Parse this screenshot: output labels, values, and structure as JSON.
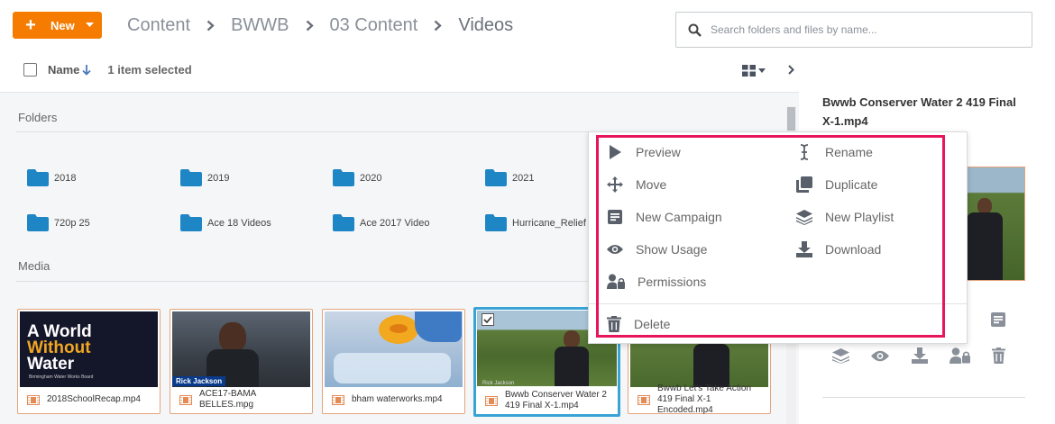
{
  "toolbar": {
    "new_label": "New",
    "breadcrumbs": [
      "Content",
      "BWWB",
      "03 Content",
      "Videos"
    ],
    "search_placeholder": "Search folders and files by name..."
  },
  "list_header": {
    "sort_label": "Name",
    "selection_text": "1 item selected"
  },
  "sections": {
    "folders": "Folders",
    "media": "Media"
  },
  "folders": [
    "2018",
    "2019",
    "2020",
    "2021",
    "720p 25",
    "Ace 18 Videos",
    "Ace 2017 Video",
    "Hurricane_Relief"
  ],
  "media": [
    {
      "name": "2018SchoolRecap.mp4",
      "overlay_line1": "A World",
      "overlay_line2": "Without",
      "overlay_line3": "Water",
      "overlay_sub": "Birmingham Water Works Board",
      "selected": false
    },
    {
      "name": "ACE17-BAMA BELLES.mpg",
      "overlay_name": "Rick Jackson",
      "selected": false
    },
    {
      "name": "bham waterworks.mp4",
      "selected": false
    },
    {
      "name": "Bwwb Conserver Water 2 419 Final X-1.mp4",
      "overlay_name": "Rick Jackson",
      "selected": true
    },
    {
      "name": "Bwwb Let's Take Action 419 Final X-1 Encoded.mp4",
      "selected": false
    }
  ],
  "context_menu": {
    "left": [
      "Preview",
      "Move",
      "New Campaign",
      "Show Usage",
      "Permissions"
    ],
    "right": [
      "Rename",
      "Duplicate",
      "New Playlist",
      "Download"
    ],
    "delete": "Delete"
  },
  "details_panel": {
    "title": "Bwwb Conserver Water 2 419 Final X-1.mp4"
  },
  "colors": {
    "accent": "#f57c00",
    "folder": "#1f86c6",
    "selection": "#3aa3d6",
    "highlight": "#e8155b"
  }
}
